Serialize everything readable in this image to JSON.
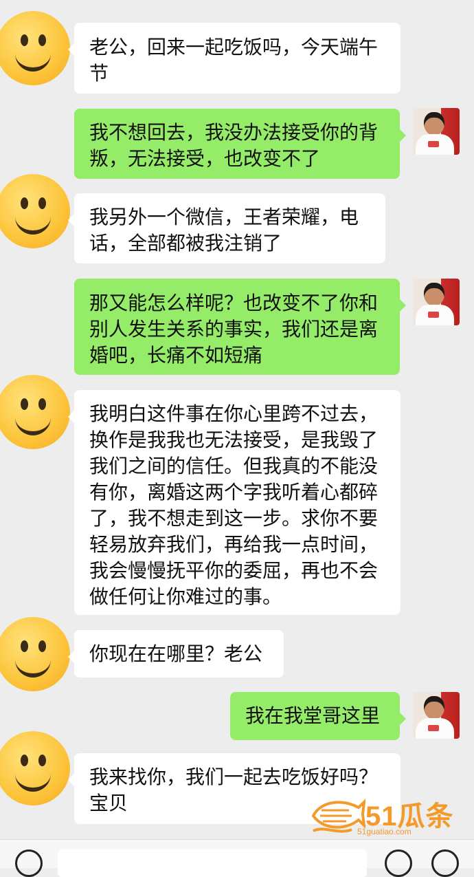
{
  "messages": [
    {
      "side": "left",
      "text": "老公，回来一起吃饭吗，今天端午节"
    },
    {
      "side": "right",
      "text": "我不想回去，我没办法接受你的背叛，无法接受，也改变不了"
    },
    {
      "side": "left",
      "text": "我另外一个微信，王者荣耀，电话，全部都被我注销了"
    },
    {
      "side": "right",
      "text": "那又能怎么样呢？也改变不了你和别人发生关系的事实，我们还是离婚吧，长痛不如短痛"
    },
    {
      "side": "left",
      "text": "我明白这件事在你心里跨不过去，换作是我我也无法接受，是我毁了我们之间的信任。但我真的不能没有你，离婚这两个字我听着心都碎了，我不想走到这一步。求你不要轻易放弃我们，再给我一点时间，我会慢慢抚平你的委屈，再也不会做任何让你难过的事。"
    },
    {
      "side": "left",
      "text": "你现在在哪里？老公"
    },
    {
      "side": "right",
      "text": "我在我堂哥这里"
    },
    {
      "side": "left",
      "text": "我来找你，我们一起去吃饭好吗？宝贝"
    }
  ],
  "watermark": {
    "brand": "51瓜条",
    "url": "51guatiao.com"
  },
  "icons": {
    "left_avatar": "smiley-face-icon",
    "right_avatar": "user-photo-avatar",
    "voice": "voice-icon",
    "emoji": "emoji-icon",
    "plus": "plus-icon"
  }
}
